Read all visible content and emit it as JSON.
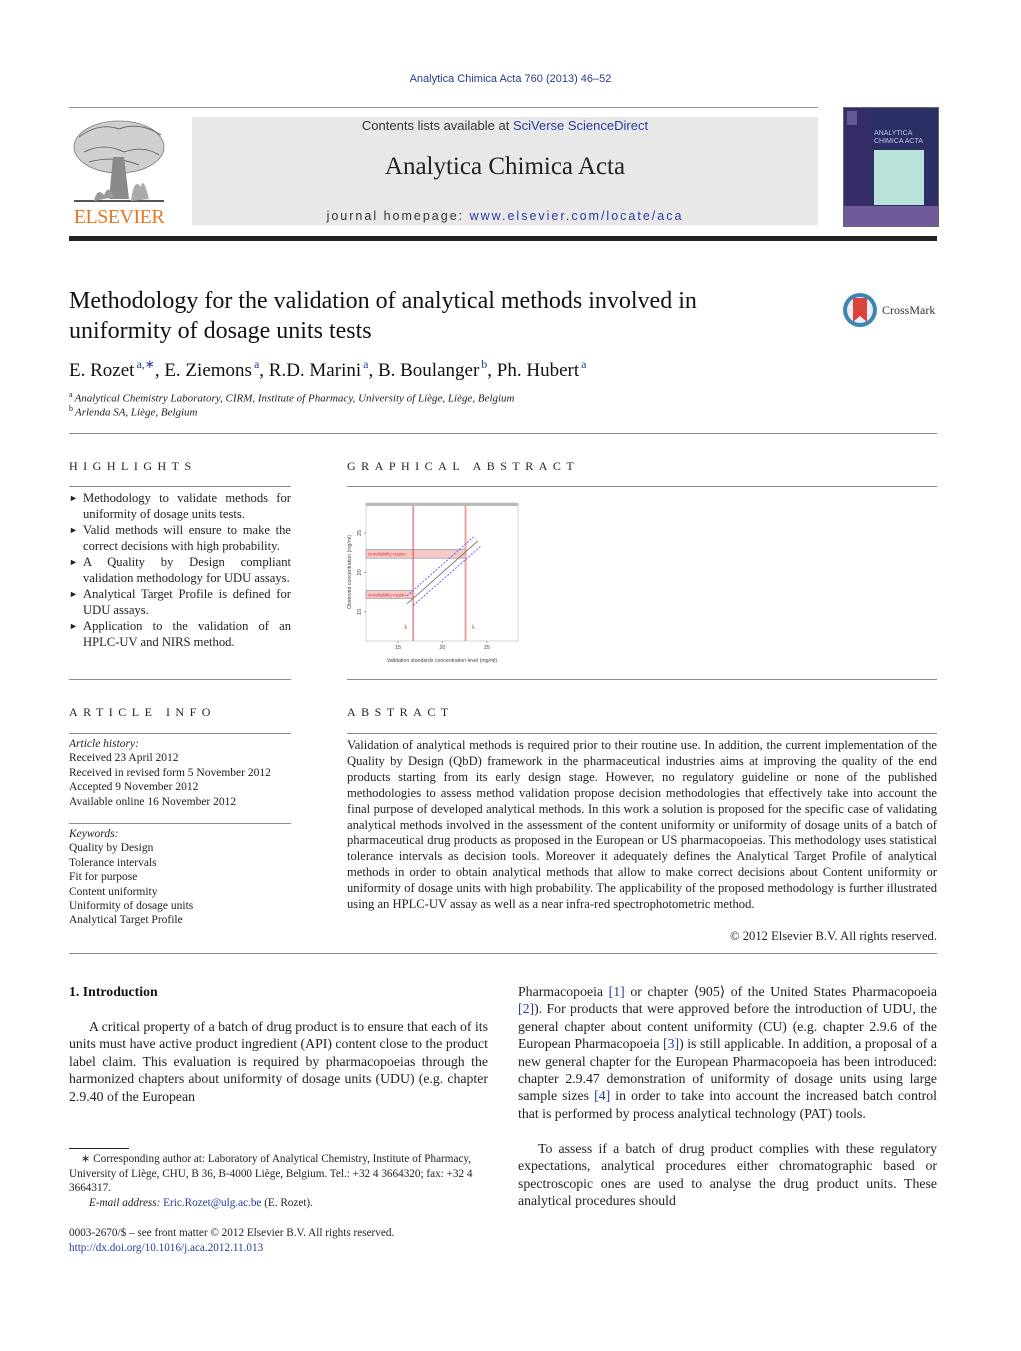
{
  "header": {
    "citation": "Analytica Chimica Acta 760 (2013) 46–52",
    "contents_prefix": "Contents lists available at ",
    "contents_link": "SciVerse ScienceDirect",
    "journal_name": "Analytica Chimica Acta",
    "homepage_prefix": "journal homepage: ",
    "homepage_link": "www.elsevier.com/locate/aca",
    "publisher_logo_text": "ELSEVIER",
    "cover_title_line1": "ANALYTICA",
    "cover_title_line2": "CHIMICA ACTA",
    "crossmark_label": "CrossMark"
  },
  "article": {
    "title": "Methodology for the validation of analytical methods involved in uniformity of dosage units tests",
    "authors": [
      {
        "name": "E. Rozet",
        "sup": "a,∗"
      },
      {
        "name": "E. Ziemons",
        "sup": "a"
      },
      {
        "name": "R.D. Marini",
        "sup": "a"
      },
      {
        "name": "B. Boulanger",
        "sup": "b"
      },
      {
        "name": "Ph. Hubert",
        "sup": "a"
      }
    ],
    "affiliations": [
      {
        "sup": "a",
        "text": "Analytical Chemistry Laboratory, CIRM, Institute of Pharmacy, University of Liège, Liège, Belgium"
      },
      {
        "sup": "b",
        "text": "Arlenda SA, Liège, Belgium"
      }
    ]
  },
  "highlights": {
    "label": "HIGHLIGHTS",
    "items": [
      "Methodology to validate methods for uniformity of dosage units tests.",
      "Valid methods will ensure to make the correct decisions with high probability.",
      "A Quality by Design compliant validation methodology for UDU assays.",
      "Analytical Target Profile is defined for UDU assays.",
      "Application to the validation of an HPLC-UV and NIRS method."
    ]
  },
  "graphical_abstract": {
    "label": "GRAPHICAL ABSTRACT"
  },
  "chart_data": {
    "type": "line",
    "title": "",
    "xlabel": "Validation standards concentration level (mg/ml)",
    "ylabel": "Observed concentration (mg/ml)",
    "xlim": [
      11.4,
      28.5
    ],
    "ylim": [
      11.3,
      28.8
    ],
    "xticks": [
      15,
      20,
      25
    ],
    "yticks": [
      15,
      20,
      25
    ],
    "grid": false,
    "series": [
      {
        "name": "identity",
        "color": "#777777",
        "style": "solid",
        "x": [
          16,
          24
        ],
        "y": [
          16,
          24
        ]
      },
      {
        "name": "upper tolerance limit",
        "color": "#5555ee",
        "style": "dashed",
        "x": [
          16,
          23.5
        ],
        "y": [
          17,
          24.5
        ]
      },
      {
        "name": "lower tolerance limit",
        "color": "#5555ee",
        "style": "dashed",
        "x": [
          16.7,
          24.3
        ],
        "y": [
          15.8,
          23.3
        ]
      }
    ],
    "vertical_lines": [
      {
        "x": 16.7,
        "color": "#e0474c",
        "label": "λ"
      },
      {
        "x": 22.6,
        "color": "#f0a0a0",
        "label": "λ"
      }
    ],
    "regions": [
      {
        "label": "Unreliability region",
        "y": [
          21.8,
          22.9
        ],
        "x_end": 22.6
      },
      {
        "label": "Unreliability region",
        "y": [
          16.7,
          17.7
        ],
        "x_end": 16.7
      }
    ]
  },
  "article_info": {
    "label": "ARTICLE INFO",
    "history_heading": "Article history:",
    "history": [
      "Received 23 April 2012",
      "Received in revised form 5 November 2012",
      "Accepted 9 November 2012",
      "Available online 16 November 2012"
    ],
    "keywords_heading": "Keywords:",
    "keywords": [
      "Quality by Design",
      "Tolerance intervals",
      "Fit for purpose",
      "Content uniformity",
      "Uniformity of dosage units",
      "Analytical Target Profile"
    ]
  },
  "abstract": {
    "label": "ABSTRACT",
    "text": "Validation of analytical methods is required prior to their routine use. In addition, the current implementation of the Quality by Design (QbD) framework in the pharmaceutical industries aims at improving the quality of the end products starting from its early design stage. However, no regulatory guideline or none of the published methodologies to assess method validation propose decision methodologies that effectively take into account the final purpose of developed analytical methods. In this work a solution is proposed for the specific case of validating analytical methods involved in the assessment of the content uniformity or uniformity of dosage units of a batch of pharmaceutical drug products as proposed in the European or US pharmacopoeias. This methodology uses statistical tolerance intervals as decision tools. Moreover it adequately defines the Analytical Target Profile of analytical methods in order to obtain analytical methods that allow to make correct decisions about Content uniformity or uniformity of dosage units with high probability. The applicability of the proposed methodology is further illustrated using an HPLC-UV assay as well as a near infra-red spectrophotometric method.",
    "copyright": "© 2012 Elsevier B.V. All rights reserved."
  },
  "body": {
    "section_heading": "1.  Introduction",
    "left_para": "A critical property of a batch of drug product is to ensure that each of its units must have active product ingredient (API) content close to the product label claim. This evaluation is required by pharmacopoeias through the harmonized chapters about uniformity of dosage units (UDU) (e.g. chapter 2.9.40 of the European",
    "right_para1": {
      "t1": "Pharmacopoeia ",
      "r1": "[1]",
      "t2": " or chapter ⟨905⟩ of the United States Pharmacopoeia ",
      "r2": "[2]",
      "t3": "). For products that were approved before the introduction of UDU, the general chapter about content uniformity (CU) (e.g. chapter 2.9.6 of the European Pharmacopoeia ",
      "r3": "[3]",
      "t4": ") is still applicable. In addition, a proposal of a new general chapter for the European Pharmacopoeia has been introduced: chapter 2.9.47 demonstration of uniformity of dosage units using large sample sizes ",
      "r4": "[4]",
      "t5": " in order to take into account the increased batch control that is performed by process analytical technology (PAT) tools."
    },
    "right_para2": "To assess if a batch of drug product complies with these regulatory expectations, analytical procedures either chromatographic based or spectroscopic ones are used to analyse the drug product units. These analytical procedures should"
  },
  "footnotes": {
    "corresponding": "∗  Corresponding author at: Laboratory of Analytical Chemistry, Institute of Pharmacy, University of Liège, CHU, B 36, B-4000 Liège, Belgium. Tel.: +32 4 3664320; fax: +32 4 3664317.",
    "email_label": "E-mail address: ",
    "email": "Eric.Rozet@ulg.ac.be",
    "email_suffix": " (E. Rozet).",
    "issn": "0003-2670/$ – see front matter © 2012 Elsevier B.V. All rights reserved.",
    "doi": "http://dx.doi.org/10.1016/j.aca.2012.11.013"
  }
}
